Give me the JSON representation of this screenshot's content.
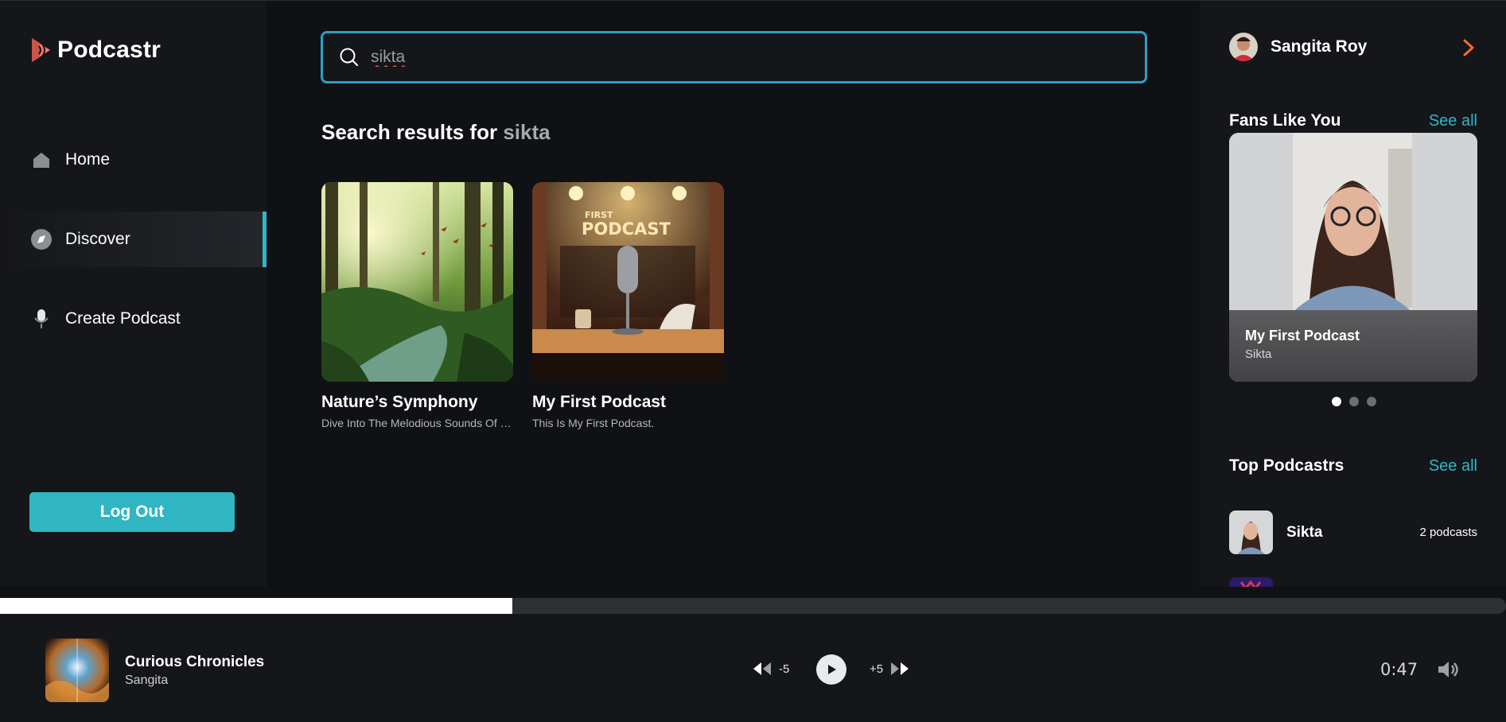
{
  "brand": {
    "name": "Podcastr"
  },
  "nav": {
    "items": [
      {
        "label": "Home",
        "icon": "home-icon"
      },
      {
        "label": "Discover",
        "icon": "compass-icon",
        "active": true
      },
      {
        "label": "Create Podcast",
        "icon": "microphone-icon"
      }
    ],
    "logout_label": "Log Out"
  },
  "search": {
    "value": "sikta",
    "placeholder": ""
  },
  "results": {
    "heading_prefix": "Search results for",
    "query": "sikta",
    "items": [
      {
        "title": "Nature’s Symphony",
        "description": "Dive Into The Melodious Sounds Of Nature"
      },
      {
        "title": "My First Podcast",
        "description": "This Is My First Podcast."
      }
    ],
    "cover2_text": {
      "line1": "FIRST",
      "line2": "PODCAST"
    }
  },
  "profile": {
    "name": "Sangita Roy"
  },
  "fans": {
    "title": "Fans Like You",
    "see_all": "See all",
    "card": {
      "title": "My First Podcast",
      "author": "Sikta"
    }
  },
  "top_podcasters": {
    "title": "Top Podcastrs",
    "see_all": "See all",
    "items": [
      {
        "name": "Sikta",
        "count": "2 podcasts"
      }
    ]
  },
  "player": {
    "title": "Curious Chronicles",
    "artist": "Sangita",
    "rewind_label": "-5",
    "forward_label": "+5",
    "time": "0:47",
    "progress": 0.34
  },
  "colors": {
    "accent": "#2fb7c5",
    "brand": "#f07b6b",
    "arrow": "#f26b2a"
  }
}
